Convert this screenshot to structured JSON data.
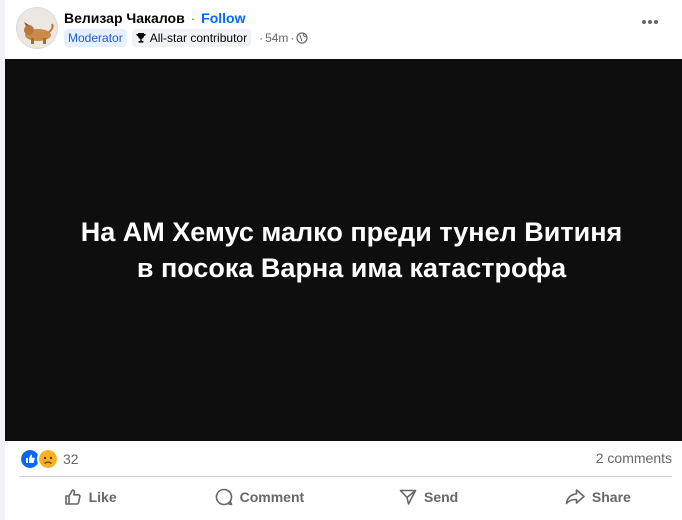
{
  "post": {
    "author_name": "Велизар Чакалов",
    "separator": "·",
    "follow_label": "Follow",
    "badges": {
      "moderator": "Moderator",
      "all_star": "All-star contributor"
    },
    "time": "54m",
    "time_sep": "·",
    "visibility_icon": "globe-icon",
    "more_icon": "more-dots-icon"
  },
  "media": {
    "text_line1": "На АМ Хемус малко преди тунел Витиня",
    "text_line2": "в посока Варна има катастрофа"
  },
  "stats": {
    "reaction_icons": [
      "like-icon",
      "sad-icon"
    ],
    "reaction_count": "32",
    "comments": "2 comments"
  },
  "actions": {
    "like": "Like",
    "comment": "Comment",
    "send": "Send",
    "share": "Share"
  },
  "colors": {
    "accent": "#0866ff",
    "muted": "#65676b",
    "media_bg": "#0e0e0e",
    "sad_yellow": "#f7b125"
  }
}
